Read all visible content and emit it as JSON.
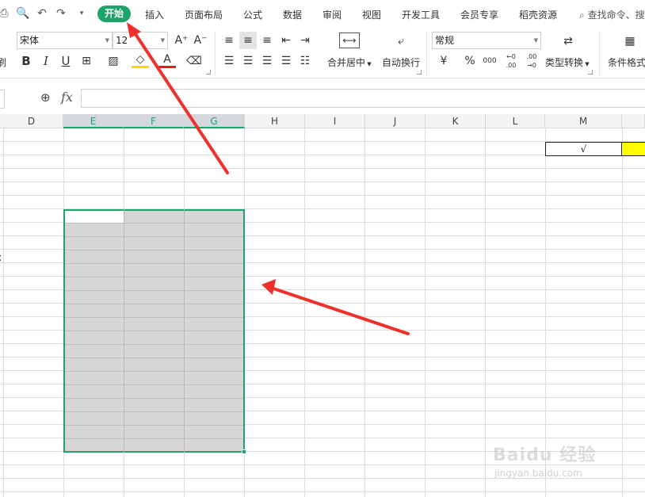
{
  "menubar": {
    "tabs": [
      "开始",
      "插入",
      "页面布局",
      "公式",
      "数据",
      "审阅",
      "视图",
      "开发工具",
      "会员专享",
      "稻壳资源"
    ],
    "active_tab": "开始",
    "search_text": "查找命令、搜"
  },
  "ribbon": {
    "font_name": "宋体",
    "font_size": "12",
    "number_format": "常规",
    "merge_label": "合并居中",
    "wrap_label": "自动换行",
    "convert_label": "类型转换",
    "cond_format_label": "条件格式",
    "bold": "B",
    "italic": "I",
    "underline": "U",
    "grow_font": "A⁺",
    "shrink_font": "A⁻",
    "currency": "¥",
    "percent": "%",
    "thousands": "000",
    "inc_decimal": "←0 .00",
    "dec_decimal": ".00 →0",
    "font_color_letter": "A",
    "left_fragment": "刷"
  },
  "formula_bar": {
    "fx": "fx",
    "value": ""
  },
  "columns": [
    "D",
    "E",
    "F",
    "G",
    "H",
    "I",
    "J",
    "K",
    "L",
    "M"
  ],
  "selected_columns": [
    "E",
    "F",
    "G"
  ],
  "cells": {
    "m2": "√"
  },
  "colors": {
    "accent": "#1ea46b",
    "selection_fill": "#d6d6d6",
    "highlight_yellow": "#ffff00",
    "arrow": "#f0312a"
  },
  "watermark": {
    "brand": "Baidu 经验",
    "url": "jingyan.baidu.com"
  }
}
